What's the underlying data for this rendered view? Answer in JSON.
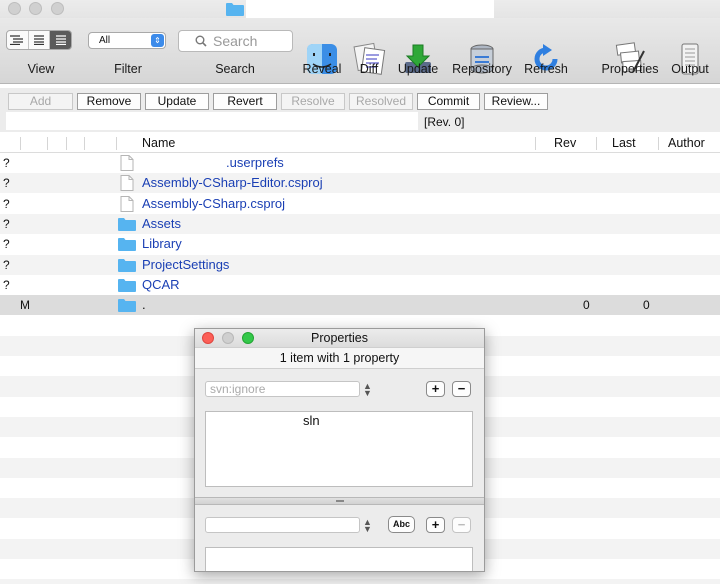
{
  "window": {
    "title": ""
  },
  "toolbar": {
    "view_label": "View",
    "filter_label": "Filter",
    "filter_value": "All",
    "search_label": "Search",
    "search_placeholder": "Search",
    "reveal_label": "Reveal",
    "diff_label": "Diff",
    "update_label": "Update",
    "repository_label": "Repository",
    "refresh_label": "Refresh",
    "properties_label": "Properties",
    "output_label": "Output"
  },
  "actions": {
    "add": "Add",
    "remove": "Remove",
    "update": "Update",
    "revert": "Revert",
    "resolve": "Resolve",
    "resolved": "Resolved",
    "commit": "Commit",
    "review": "Review...",
    "path_value": "",
    "revision": "[Rev. 0]"
  },
  "table": {
    "columns": {
      "name": "Name",
      "rev": "Rev",
      "last": "Last",
      "author": "Author"
    },
    "rows": [
      {
        "status": "?",
        "name": ".userprefs",
        "type": "file",
        "rev": "",
        "last": ""
      },
      {
        "status": "?",
        "name": "Assembly-CSharp-Editor.csproj",
        "type": "file",
        "rev": "",
        "last": ""
      },
      {
        "status": "?",
        "name": "Assembly-CSharp.csproj",
        "type": "file",
        "rev": "",
        "last": ""
      },
      {
        "status": "?",
        "name": "Assets",
        "type": "folder",
        "rev": "",
        "last": ""
      },
      {
        "status": "?",
        "name": "Library",
        "type": "folder",
        "rev": "",
        "last": ""
      },
      {
        "status": "?",
        "name": "ProjectSettings",
        "type": "folder",
        "rev": "",
        "last": ""
      },
      {
        "status": "?",
        "name": "QCAR",
        "type": "folder",
        "rev": "",
        "last": ""
      },
      {
        "status": "M",
        "name": ".",
        "type": "folder",
        "rev": "0",
        "last": "0"
      }
    ]
  },
  "properties_panel": {
    "title": "Properties",
    "summary": "1 item with 1 property",
    "property_name": "svn:ignore",
    "property_value": "sln",
    "new_property_name": "",
    "new_property_value": "",
    "add_symbol": "+",
    "remove_symbol": "−",
    "abc_label": "Abc"
  },
  "colors": {
    "link_blue": "#1a3fb4",
    "folder_blue": "#56b4f0",
    "close_red": "#fc5f57",
    "minimize_gray": "#cfcfcf",
    "zoom_green": "#34c84a"
  }
}
